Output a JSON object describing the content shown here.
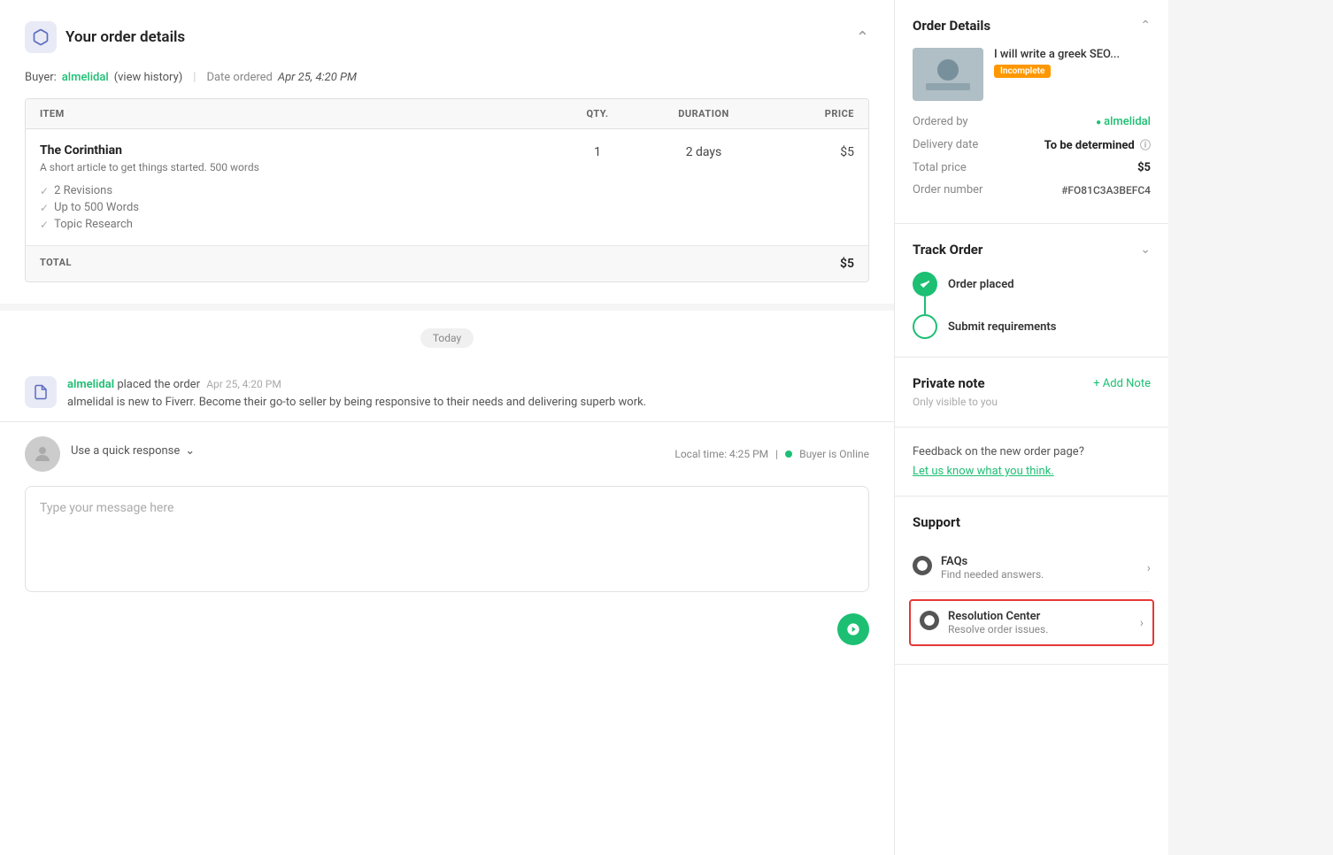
{
  "page": {
    "order_section_title": "Your order details",
    "buyer_label": "Buyer:",
    "buyer_name": "almelidal",
    "view_history": "(view history)",
    "date_label": "Date ordered",
    "date_value": "Apr 25, 4:20 PM",
    "table": {
      "headers": [
        "ITEM",
        "QTY.",
        "DURATION",
        "PRICE"
      ],
      "rows": [
        {
          "name": "The Corinthian",
          "description": "A short article to get things started. 500 words",
          "features": [
            "2 Revisions",
            "Up to 500 Words",
            "Topic Research"
          ],
          "qty": "1",
          "duration": "2 days",
          "price": "$5"
        }
      ],
      "total_label": "TOTAL",
      "total_price": "$5"
    }
  },
  "chat": {
    "today_label": "Today",
    "activity": {
      "user": "almelidal",
      "action": "placed the order",
      "time": "Apr 25, 4:20 PM",
      "description": "almelidal is new to Fiverr. Become their go-to seller by being responsive to their needs and delivering superb work."
    },
    "quick_response_label": "Use a quick response",
    "local_time_label": "Local time: 4:25 PM",
    "buyer_status": "Buyer is Online",
    "message_placeholder": "Type your message here"
  },
  "sidebar": {
    "order_details": {
      "title": "Order Details",
      "gig_title": "I will write a greek SEO...",
      "gig_status": "Incomplete",
      "ordered_by_label": "Ordered by",
      "ordered_by_value": "almelidal",
      "delivery_date_label": "Delivery date",
      "delivery_date_value": "To be determined",
      "total_price_label": "Total price",
      "total_price_value": "$5",
      "order_number_label": "Order number",
      "order_number_value": "#FO81C3A3BEFC4"
    },
    "track_order": {
      "title": "Track Order",
      "steps": [
        {
          "label": "Order placed",
          "complete": true
        },
        {
          "label": "Submit requirements",
          "complete": false
        }
      ]
    },
    "private_note": {
      "title": "Private note",
      "add_note_label": "+ Add Note",
      "subtitle": "Only visible to you"
    },
    "feedback": {
      "title": "Feedback on the new order page?",
      "link_text": "Let us know what you think."
    },
    "support": {
      "title": "Support",
      "items": [
        {
          "icon": "question-icon",
          "title": "FAQs",
          "subtitle": "Find needed answers.",
          "highlighted": false
        },
        {
          "icon": "resolution-icon",
          "title": "Resolution Center",
          "subtitle": "Resolve order issues.",
          "highlighted": true
        }
      ]
    }
  }
}
